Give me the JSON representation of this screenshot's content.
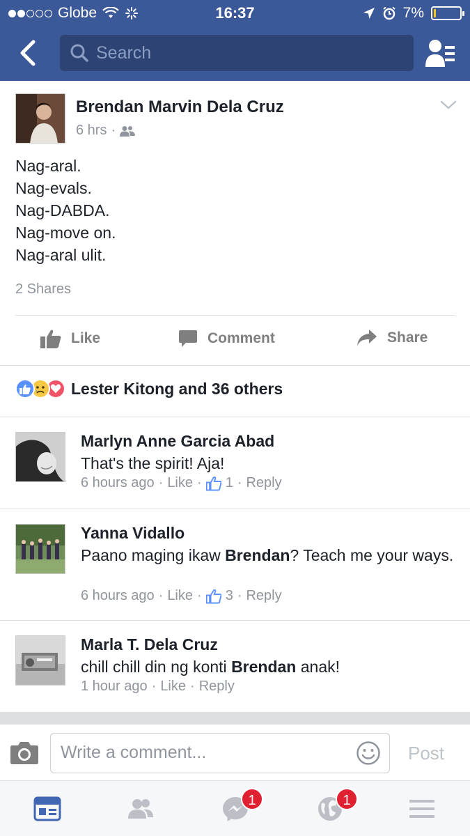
{
  "status_bar": {
    "carrier": "Globe",
    "time": "16:37",
    "battery": "7%",
    "battery_level": 0.07
  },
  "header": {
    "search_placeholder": "Search",
    "icons": [
      "back-chevron-icon",
      "search-icon",
      "friend-list-icon"
    ]
  },
  "post": {
    "author": "Brendan Marvin Dela Cruz",
    "time": "6 hrs",
    "privacy_icon": "friends-icon",
    "lines": [
      "Nag-aral.",
      "Nag-evals.",
      "Nag-DABDA.",
      "Nag-move on.",
      "Nag-aral ulit."
    ],
    "shares": "2 Shares",
    "actions": {
      "like": "Like",
      "comment": "Comment",
      "share": "Share"
    },
    "reactions_text": "Lester Kitong and 36 others",
    "reaction_icons": [
      "like-reaction-icon",
      "sad-reaction-icon",
      "love-reaction-icon"
    ]
  },
  "comments": [
    {
      "name": "Marlyn Anne Garcia Abad",
      "text_parts": [
        "That's the spirit! Aja!"
      ],
      "time": "6 hours ago",
      "like": "Like",
      "likes_count": "1",
      "reply": "Reply"
    },
    {
      "name": "Yanna Vidallo",
      "text_before": "Paano maging ikaw ",
      "text_bold": "Brendan",
      "text_after": "? Teach me your ways.",
      "time": "6 hours ago",
      "like": "Like",
      "likes_count": "3",
      "reply": "Reply"
    },
    {
      "name": "Marla T. Dela Cruz",
      "text_before": "chill chill din ng konti ",
      "text_bold": "Brendan",
      "text_after": " anak!",
      "time": "1 hour ago",
      "like": "Like",
      "reply": "Reply"
    }
  ],
  "composer": {
    "placeholder": "Write a comment...",
    "post_label": "Post"
  },
  "tab_bar": {
    "messenger_badge": "1",
    "notifications_badge": "1"
  },
  "colors": {
    "brand": "#3b5998",
    "text": "#1d2129",
    "muted": "#90949c",
    "badge": "#e02131"
  }
}
